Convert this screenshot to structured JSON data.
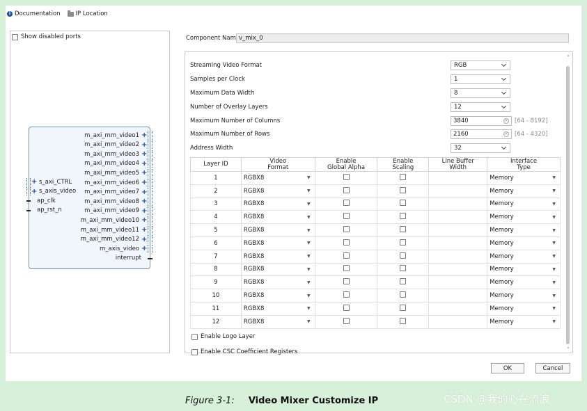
{
  "toolbar": {
    "documentation_label": "Documentation",
    "ip_location_label": "IP Location"
  },
  "left_panel": {
    "show_disabled_ports_label": "Show disabled ports",
    "ip_block": {
      "right_ports": [
        "m_axi_mm_video1",
        "m_axi_mm_video2",
        "m_axi_mm_video3",
        "m_axi_mm_video4",
        "m_axi_mm_video5",
        "m_axi_mm_video6",
        "m_axi_mm_video7",
        "m_axi_mm_video8",
        "m_axi_mm_video9",
        "m_axi_mm_video10",
        "m_axi_mm_video11",
        "m_axi_mm_video12",
        "m_axis_video"
      ],
      "interrupt_label": "interrupt",
      "left_ports": {
        "s_axi_ctrl": "s_axi_CTRL",
        "s_axis_video": "s_axis_video",
        "ap_clk": "ap_clk",
        "ap_rst_n": "ap_rst_n"
      }
    }
  },
  "component": {
    "label": "Component Name",
    "value": "v_mix_0"
  },
  "settings": {
    "streaming_video_format": {
      "label": "Streaming Video Format",
      "value": "RGB"
    },
    "samples_per_clock": {
      "label": "Samples per Clock",
      "value": "1"
    },
    "maximum_data_width": {
      "label": "Maximum Data Width",
      "value": "8"
    },
    "number_of_overlay_layers": {
      "label": "Number of Overlay Layers",
      "value": "12"
    },
    "maximum_number_of_columns": {
      "label": "Maximum Number of Columns",
      "value": "3840",
      "range": "[64 - 8192]"
    },
    "maximum_number_of_rows": {
      "label": "Maximum Number of Rows",
      "value": "2160",
      "range": "[64 - 4320]"
    },
    "address_width": {
      "label": "Address Width",
      "value": "32"
    }
  },
  "layer_table": {
    "headers": {
      "layer_id": "Layer ID",
      "video_format_1": "Video",
      "video_format_2": "Format",
      "global_alpha_1": "Enable",
      "global_alpha_2": "Global Alpha",
      "scaling_1": "Enable",
      "scaling_2": "Scaling",
      "line_buffer_1": "Line Buffer",
      "line_buffer_2": "Width",
      "interface_1": "Interface",
      "interface_2": "Type"
    },
    "rows": [
      {
        "id": "1",
        "format": "RGBX8",
        "interface": "Memory"
      },
      {
        "id": "2",
        "format": "RGBX8",
        "interface": "Memory"
      },
      {
        "id": "3",
        "format": "RGBX8",
        "interface": "Memory"
      },
      {
        "id": "4",
        "format": "RGBX8",
        "interface": "Memory"
      },
      {
        "id": "5",
        "format": "RGBX8",
        "interface": "Memory"
      },
      {
        "id": "6",
        "format": "RGBX8",
        "interface": "Memory"
      },
      {
        "id": "7",
        "format": "RGBX8",
        "interface": "Memory"
      },
      {
        "id": "8",
        "format": "RGBX8",
        "interface": "Memory"
      },
      {
        "id": "9",
        "format": "RGBX8",
        "interface": "Memory"
      },
      {
        "id": "10",
        "format": "RGBX8",
        "interface": "Memory"
      },
      {
        "id": "11",
        "format": "RGBX8",
        "interface": "Memory"
      },
      {
        "id": "12",
        "format": "RGBX8",
        "interface": "Memory"
      }
    ]
  },
  "options": {
    "enable_logo_layer": "Enable Logo Layer",
    "enable_csc": "Enable CSC Coefficient Registers"
  },
  "buttons": {
    "ok": "OK",
    "cancel": "Cancel"
  },
  "caption": {
    "figure": "Figure 3-1:",
    "title": "Video Mixer Customize IP"
  },
  "watermark": "CSDN @我的心在流浪"
}
